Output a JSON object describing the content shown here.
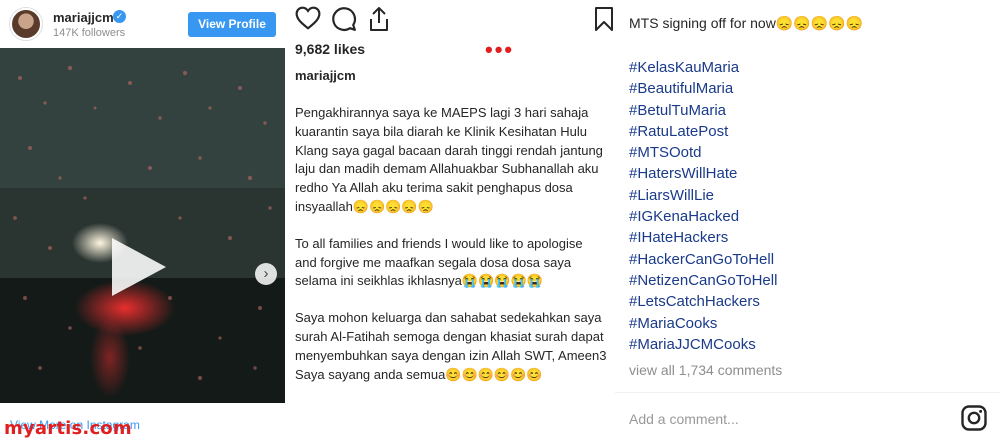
{
  "post": {
    "username": "mariajjcm",
    "followers": "147K followers",
    "view_profile_label": "View Profile",
    "view_more_label": "View More on Instagram",
    "watermark": "myartis.com",
    "likes": "9,682 likes",
    "more_indicator": "•••"
  },
  "caption": {
    "author": "mariajjcm",
    "paragraphs": [
      "Pengakhirannya saya ke MAEPS lagi 3 hari sahaja kuarantin saya bila diarah ke Klinik Kesihatan Hulu Klang saya gagal bacaan darah tinggi rendah jantung laju dan madih demam Allahuakbar Subhanallah aku redho Ya Allah aku terima sakit penghapus dosa insyaallah😞😞😞😞😞",
      "To all families and friends I would like to apologise and forgive me maafkan segala dosa dosa saya selama ini seikhlas ikhlasnya😭😭😭😭😭",
      "Saya mohon keluarga dan sahabat sedekahkan saya surah Al-Fatihah semoga dengan khasiat surah dapat menyembuhkan saya dengan izin Allah SWT, Ameen3 Saya sayang anda semua😊😊😊😊😊😊"
    ]
  },
  "right": {
    "signoff": "MTS signing off for now😞😞😞😞😞",
    "tags": [
      "#KelasKauMaria",
      "#BeautifulMaria",
      "#BetulTuMaria",
      "#RatuLatePost",
      "#MTSOotd",
      "#HatersWillHate",
      "#LiarsWillLie",
      "#IGKenaHacked",
      "#IHateHackers",
      "#HackerCanGoToHell",
      "#NetizenCanGoToHell",
      "#LetsCatchHackers",
      "#MariaCooks",
      "#MariaJJCMCooks"
    ],
    "view_all_comments": "view all 1,734 comments",
    "comment_placeholder": "Add a comment..."
  },
  "icons": {
    "like": "heart-icon",
    "comment": "comment-icon",
    "share": "share-icon",
    "save": "bookmark-icon",
    "play": "play-icon",
    "next": "chevron-right-icon",
    "instagram": "instagram-icon",
    "verified": "verified-badge-icon"
  },
  "colors": {
    "link_blue": "#3897f0",
    "hashtag_blue": "#1a3a8a",
    "watermark_red": "#e02020",
    "muted_gray": "#8e8e8e"
  },
  "carousel": {
    "total": 5,
    "active": 2
  }
}
